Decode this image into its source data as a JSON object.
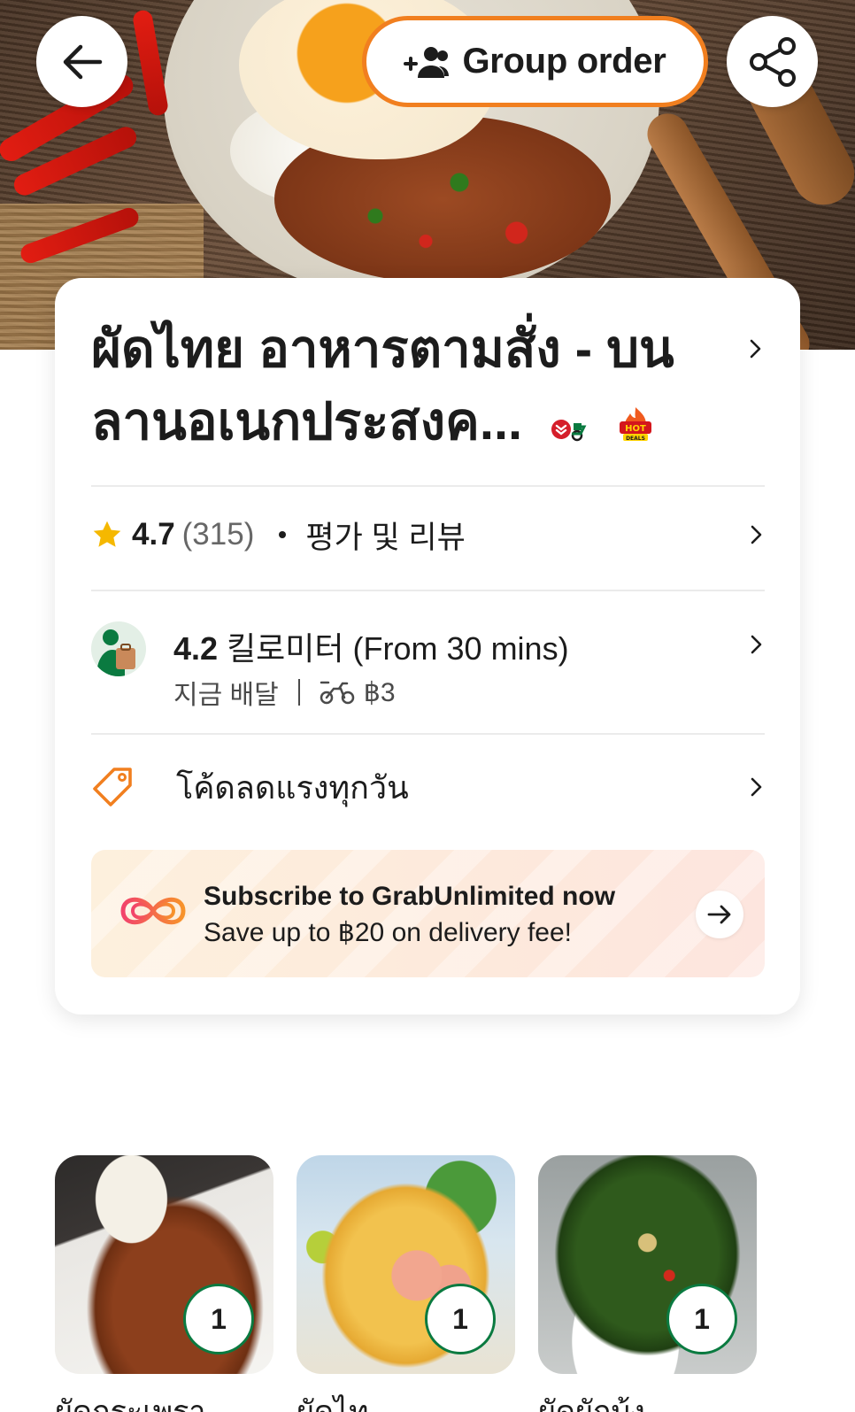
{
  "header": {
    "group_order_label": "Group order",
    "back_icon": "arrow-left-icon",
    "share_icon": "share-icon",
    "group_icon": "add-group-icon"
  },
  "restaurant": {
    "name": "ผัดไทย อาหารตามสั่ง - บน ลานอเนกประสงค...",
    "badges": [
      "saver-delivery-badge",
      "hot-deals-badge"
    ]
  },
  "rating": {
    "value": "4.7",
    "count": "(315)",
    "reviews_label": "평가 및 리뷰"
  },
  "delivery": {
    "distance": "4.2",
    "distance_text": "킬로미터 (From 30 mins)",
    "mode": "지금 배달",
    "fee": "฿3"
  },
  "promo": {
    "label": "โค้ดลดแรงทุกวัน"
  },
  "subscription": {
    "title": "Subscribe to GrabUnlimited now",
    "subtitle": "Save up to ฿20 on delivery fee!"
  },
  "dishes": [
    {
      "name": "ผัดกระเพรา",
      "qty": "1"
    },
    {
      "name": "ผัดไท",
      "qty": "1"
    },
    {
      "name": "ผัดผักบุ้ง",
      "qty": "1"
    }
  ],
  "colors": {
    "accent_orange": "#f17f1f",
    "grab_green": "#0a7a40",
    "star_yellow": "#f5b800"
  }
}
